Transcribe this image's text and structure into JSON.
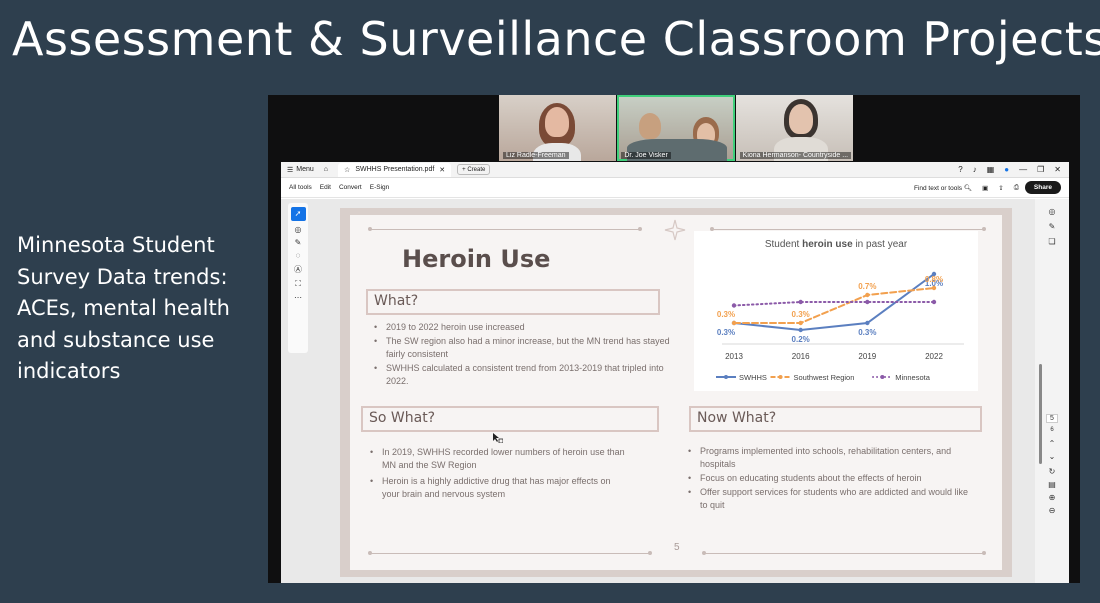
{
  "slide": {
    "title": "Assessment & Surveillance Classroom Projects",
    "side_text": "Minnesota Student Survey Data trends: ACEs, mental health and substance use indicators"
  },
  "video_tiles": [
    {
      "name": "Liz Radle-Freeman"
    },
    {
      "name": "Dr. Joe Visker"
    },
    {
      "name": "Kiona Hermanson- Countryside ..."
    }
  ],
  "acrobat": {
    "menu_label": "Menu",
    "tab_title": "SWHHS Presentation.pdf",
    "create_label": "Create",
    "tools": [
      "All tools",
      "Edit",
      "Convert",
      "E-Sign"
    ],
    "find_label": "Find text or tools",
    "share_label": "Share",
    "page_indicator": "5",
    "page_indicator_next": "6"
  },
  "pdf_page": {
    "heading": "Heroin Use",
    "what_label": "What?",
    "what_bullets": [
      "2019 to 2022 heroin use increased",
      "The SW region also had a minor increase, but the MN trend has stayed fairly consistent",
      "SWHHS calculated a consistent trend from 2013-2019 that tripled into 2022."
    ],
    "so_what_label": "So What?",
    "so_what_bullets": [
      "In 2019, SWHHS recorded lower numbers of heroin use than MN and the SW Region",
      " Heroin is a highly addictive drug that has major effects on your brain and nervous system"
    ],
    "now_what_label": "Now What?",
    "now_what_bullets": [
      "Programs implemented into schools, rehabilitation centers, and hospitals",
      "Focus on educating students about the effects of heroin",
      "Offer support services for students who are addicted and would like to quit"
    ],
    "page_number": "5"
  },
  "chart_data": {
    "type": "line",
    "title_pre": "Student ",
    "title_bold": "heroin use",
    "title_post": " in past year",
    "categories": [
      "2013",
      "2016",
      "2019",
      "2022"
    ],
    "ylim": [
      0,
      1.1
    ],
    "series": [
      {
        "name": "SWHHS",
        "color": "#5b7fc0",
        "style": "solid",
        "values": [
          0.3,
          0.2,
          0.3,
          1.0
        ],
        "labels": [
          "0.3%",
          "0.2%",
          "0.3%",
          "1.0%"
        ],
        "label_pos": "below"
      },
      {
        "name": "Southwest Region",
        "color": "#f2a04e",
        "style": "dashed",
        "values": [
          0.3,
          0.3,
          0.7,
          0.8
        ],
        "labels": [
          "0.3%",
          "0.3%",
          "0.7%",
          "0.8%"
        ],
        "label_pos": "above"
      },
      {
        "name": "Minnesota",
        "color": "#8b5aa8",
        "style": "dotted",
        "values": [
          0.55,
          0.6,
          0.6,
          0.6
        ],
        "labels": [],
        "label_pos": "none"
      }
    ],
    "legend_position": "bottom"
  }
}
